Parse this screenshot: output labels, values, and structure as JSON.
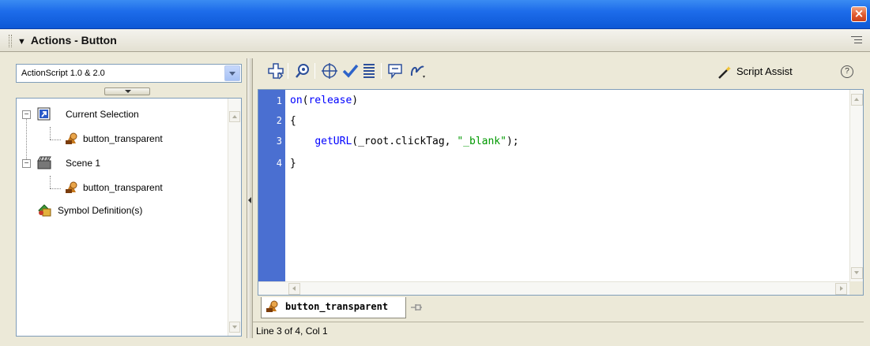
{
  "window": {
    "close_glyph": "×"
  },
  "panel": {
    "title": "Actions - Button",
    "collapse_glyph": "▼"
  },
  "left": {
    "version_selected": "ActionScript 1.0 & 2.0",
    "tree": [
      {
        "label": "Current Selection",
        "icon": "current-selection-icon"
      },
      {
        "label": "button_transparent",
        "icon": "button-symbol-icon"
      },
      {
        "label": "Scene 1",
        "icon": "scene-icon"
      },
      {
        "label": "button_transparent",
        "icon": "button-symbol-icon"
      },
      {
        "label": "Symbol Definition(s)",
        "icon": "symbol-definitions-icon"
      }
    ],
    "expander_glyph": "−"
  },
  "toolbar": {
    "script_assist_label": "Script Assist",
    "help_glyph": "?",
    "buttons": [
      "add-statement",
      "find",
      "insert-target-path",
      "check-syntax",
      "auto-format",
      "show-code-hint",
      "debug-options"
    ]
  },
  "editor": {
    "line_numbers": [
      "1",
      "2",
      "3",
      "4"
    ],
    "lines": {
      "l1_func": "on",
      "l1_paren_open": "(",
      "l1_kw": "release",
      "l1_paren_close": ")",
      "l2": "{",
      "l3_indent": "    ",
      "l3_func": "getURL",
      "l3_args_start": "(_root.clickTag, ",
      "l3_str": "\"_blank\"",
      "l3_end": ");",
      "l4": "}"
    }
  },
  "tabs": {
    "active_label": "button_transparent"
  },
  "status": {
    "text": "Line 3 of 4, Col 1"
  }
}
